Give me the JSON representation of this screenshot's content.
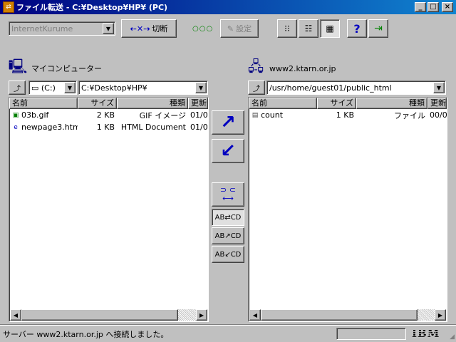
{
  "window": {
    "title": "ファイル転送 - C:¥Desktop¥HP¥ (PC)",
    "minimize": "_",
    "maximize": "□",
    "close": "×"
  },
  "toolbar": {
    "server": "InternetKurume",
    "disconnect_label": "切断",
    "status_dots": "○○○",
    "settings_label": "設定"
  },
  "local": {
    "label": "マイコンピューター",
    "drive": "(C:)",
    "path": "C:¥Desktop¥HP¥",
    "columns": [
      "名前",
      "サイズ",
      "種類",
      "更新"
    ],
    "files": [
      {
        "name": "03b.gif",
        "size": "2 KB",
        "type": "GIF イメージ",
        "date": "01/0",
        "icon": "gif-file-icon"
      },
      {
        "name": "newpage3.htm",
        "size": "1 KB",
        "type": "HTML Document",
        "date": "01/0",
        "icon": "html-file-icon"
      }
    ]
  },
  "remote": {
    "label": "www2.ktarn.or.jp",
    "path": "/usr/home/guest01/public_html",
    "columns": [
      "名前",
      "サイズ",
      "種類",
      "更新"
    ],
    "files": [
      {
        "name": "count",
        "size": "1 KB",
        "type": "ファイル",
        "date": "00/0",
        "icon": "file-icon"
      }
    ]
  },
  "transfer": {
    "compare_a": "AB",
    "compare_b": "CD"
  },
  "status": {
    "message": "サーバー www2.ktarn.or.jp へ接続しました。",
    "logo": "IBM"
  }
}
